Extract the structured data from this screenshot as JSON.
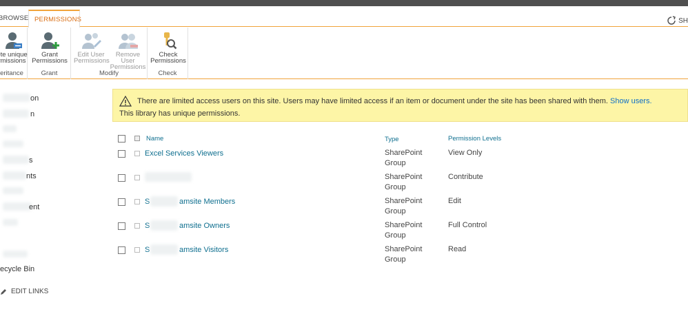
{
  "tabs": {
    "browse": "BROWSE",
    "permissions": "PERMISSIONS",
    "share": "SH"
  },
  "ribbon": {
    "delete_inheritance": {
      "line1": "ete unique",
      "line2": "rmissions"
    },
    "inheritance_label": "eritance",
    "grant_permissions": {
      "line1": "Grant",
      "line2": "Permissions"
    },
    "grant_label": "Grant",
    "edit_user_permissions": {
      "line1": "Edit User",
      "line2": "Permissions"
    },
    "remove_user_permissions": {
      "line1": "Remove User",
      "line2": "Permissions"
    },
    "modify_label": "Modify",
    "check_permissions": {
      "line1": "Check",
      "line2": "Permissions"
    },
    "check_label": "Check"
  },
  "nav": {
    "item1": "on",
    "item2": "n",
    "item3": "s",
    "item4": "nts",
    "item5": "ent",
    "recycle_bin": "ecycle Bin",
    "edit_links": "EDIT LINKS"
  },
  "notice": {
    "text": "There are limited access users on this site. Users may have limited access if an item or document under the site has been shared with them.",
    "link": "Show users.",
    "line2": "This library has unique permissions."
  },
  "table": {
    "headers": {
      "name": "Name",
      "type": "Type",
      "levels": "Permission Levels"
    },
    "rows": [
      {
        "name": "Excel Services Viewers",
        "type_line1": "SharePoint",
        "type_line2": "Group",
        "level": "View Only"
      },
      {
        "name": "",
        "type_line1": "SharePoint",
        "type_line2": "Group",
        "level": "Contribute"
      },
      {
        "name_prefix": "S",
        "name": "amsite Members",
        "type_line1": "SharePoint",
        "type_line2": "Group",
        "level": "Edit"
      },
      {
        "name_prefix": "S",
        "name": "amsite Owners",
        "type_line1": "SharePoint",
        "type_line2": "Group",
        "level": "Full Control"
      },
      {
        "name_prefix": "S",
        "name": "amsite Visitors",
        "type_line1": "SharePoint",
        "type_line2": "Group",
        "level": "Read"
      }
    ]
  },
  "colors": {
    "accent": "#f1a33a",
    "link": "#0f6f8f",
    "notice_bg": "#fdf5a6"
  }
}
